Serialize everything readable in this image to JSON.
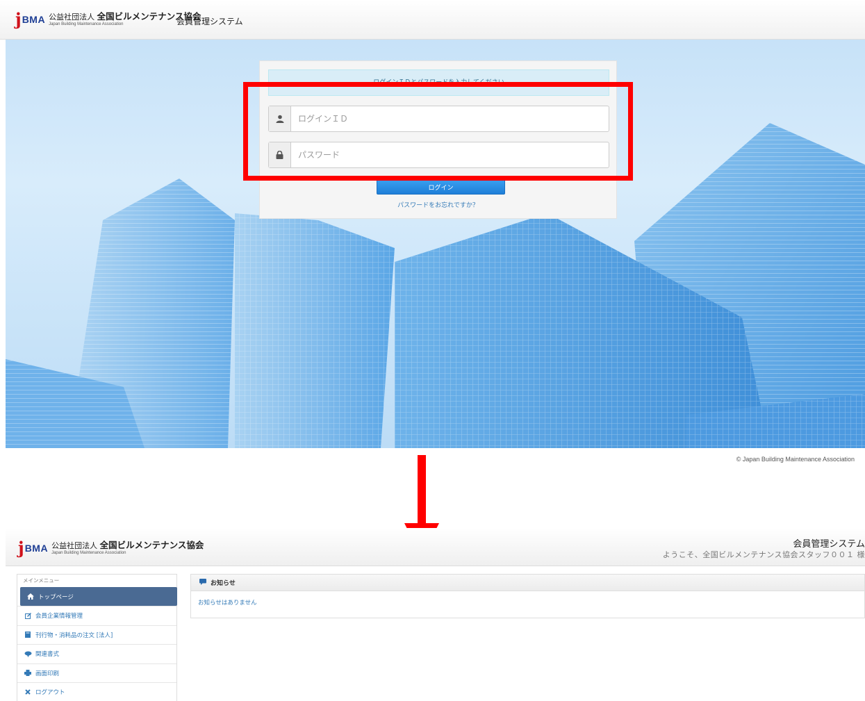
{
  "logo": {
    "mark_j": "j",
    "mark_bma": "BMA",
    "org_prefix": "公益社団法人",
    "org_name": "全国ビルメンテナンス協会",
    "org_en": "Japan Building Maintenance Association"
  },
  "login": {
    "system_title": "会員管理システム",
    "message": "ログインＩＤとパスワードを入力してください",
    "login_id_placeholder": "ログインＩＤ",
    "password_placeholder": "パスワード",
    "submit_label": "ログイン",
    "forgot_link": "パスワードをお忘れですか？",
    "copyright": "© Japan Building Maintenance Association"
  },
  "dashboard": {
    "system_title": "会員管理システム",
    "welcome": "ようこそ、全国ビルメンテナンス協会スタッフ００１ 様",
    "sidebar": {
      "heading": "メインメニュー",
      "items": [
        {
          "label": "トップページ",
          "icon": "home-icon"
        },
        {
          "label": "会員企業情報管理",
          "icon": "edit-icon"
        },
        {
          "label": "刊行物・消耗品の注文 [法人]",
          "icon": "book-icon"
        },
        {
          "label": "関連書式",
          "icon": "cloud-download-icon"
        },
        {
          "label": "画面印刷",
          "icon": "print-icon"
        },
        {
          "label": "ログアウト",
          "icon": "close-icon"
        }
      ]
    },
    "notice": {
      "title": "お知らせ",
      "empty_message": "お知らせはありません"
    }
  },
  "colors": {
    "highlight": "#ff0000",
    "arrow": "#ff0000",
    "primary_button": "#2a8ae5",
    "sidebar_active": "#4a6a93",
    "link": "#337ab7"
  }
}
